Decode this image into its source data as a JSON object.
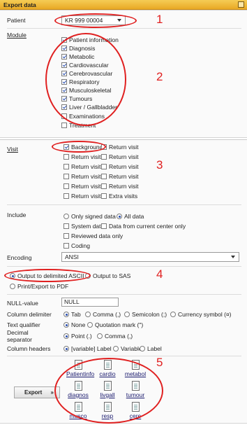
{
  "window": {
    "title": "Export data"
  },
  "patient": {
    "label": "Patient",
    "value": "KR 999 00004"
  },
  "module": {
    "label": "Module",
    "items": [
      {
        "label": "Patient information",
        "checked": true
      },
      {
        "label": "Diagnosis",
        "checked": true
      },
      {
        "label": "Metabolic",
        "checked": true
      },
      {
        "label": "Cardiovascular",
        "checked": true
      },
      {
        "label": "Cerebrovascular",
        "checked": true
      },
      {
        "label": "Respiratory",
        "checked": true
      },
      {
        "label": "Musculoskeletal",
        "checked": true
      },
      {
        "label": "Tumours",
        "checked": true
      },
      {
        "label": "Liver / Gallbladder",
        "checked": true
      },
      {
        "label": "Examinations",
        "checked": false
      },
      {
        "label": "Treatment",
        "checked": false
      }
    ]
  },
  "visit": {
    "label": "Visit",
    "rows": [
      {
        "left": "Background",
        "left_checked": true,
        "right": "Return visit"
      },
      {
        "left": "Return visit",
        "left_checked": false,
        "right": "Return visit"
      },
      {
        "left": "Return visit",
        "left_checked": false,
        "right": "Return visit"
      },
      {
        "left": "Return visit",
        "left_checked": false,
        "right": "Return visit"
      },
      {
        "left": "Return visit",
        "left_checked": false,
        "right": "Return visit"
      },
      {
        "left": "Return visit",
        "left_checked": false,
        "right": "Extra visits"
      }
    ]
  },
  "include": {
    "label": "Include",
    "only_signed": "Only signed data",
    "all_data": "All data",
    "system_data": "System data",
    "current_center": "Data from current center only",
    "reviewed": "Reviewed data only",
    "coding": "Coding"
  },
  "encoding": {
    "label": "Encoding",
    "value": "ANSI"
  },
  "output": {
    "ascii": "Output to delimited ASCII",
    "sas": "Output to SAS",
    "pdf": "Print/Export to PDF"
  },
  "options": {
    "null_label": "NULL-value",
    "null_value": "NULL",
    "col_delim_label": "Column delimiter",
    "col_delim": [
      "Tab",
      "Comma (,)",
      "Semicolon (;)",
      "Currency symbol (¤)"
    ],
    "text_qual_label": "Text qualifier",
    "text_qual": [
      "None",
      "Quotation mark (\")"
    ],
    "dec_sep_label_1": "Decimal",
    "dec_sep_label_2": "separator",
    "dec_sep": [
      "Point (.)",
      "Comma (,)"
    ],
    "col_headers_label": "Column headers",
    "col_headers": [
      "[variable] Label",
      "Variable",
      "Label"
    ]
  },
  "export_button": {
    "label": "Export",
    "chevron": "»"
  },
  "files": [
    "Patientinfo",
    "cardio",
    "metabol",
    "diagnos",
    "livgall",
    "tumour",
    "musco",
    "resp",
    "cere"
  ],
  "annotations": [
    "1",
    "2",
    "3",
    "4",
    "5"
  ],
  "colors": {
    "titlebar": "#f0b43c",
    "annotation": "#e02020",
    "check": "#2a4fb0"
  }
}
